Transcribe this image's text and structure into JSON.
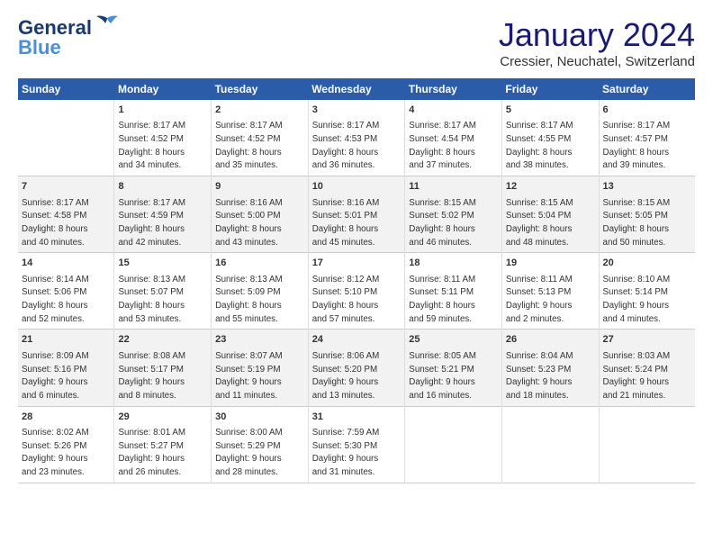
{
  "header": {
    "logo_general": "General",
    "logo_blue": "Blue",
    "main_title": "January 2024",
    "subtitle": "Cressier, Neuchatel, Switzerland"
  },
  "columns": [
    "Sunday",
    "Monday",
    "Tuesday",
    "Wednesday",
    "Thursday",
    "Friday",
    "Saturday"
  ],
  "weeks": [
    [
      {
        "num": "",
        "text": ""
      },
      {
        "num": "1",
        "text": "Sunrise: 8:17 AM\nSunset: 4:52 PM\nDaylight: 8 hours\nand 34 minutes."
      },
      {
        "num": "2",
        "text": "Sunrise: 8:17 AM\nSunset: 4:52 PM\nDaylight: 8 hours\nand 35 minutes."
      },
      {
        "num": "3",
        "text": "Sunrise: 8:17 AM\nSunset: 4:53 PM\nDaylight: 8 hours\nand 36 minutes."
      },
      {
        "num": "4",
        "text": "Sunrise: 8:17 AM\nSunset: 4:54 PM\nDaylight: 8 hours\nand 37 minutes."
      },
      {
        "num": "5",
        "text": "Sunrise: 8:17 AM\nSunset: 4:55 PM\nDaylight: 8 hours\nand 38 minutes."
      },
      {
        "num": "6",
        "text": "Sunrise: 8:17 AM\nSunset: 4:57 PM\nDaylight: 8 hours\nand 39 minutes."
      }
    ],
    [
      {
        "num": "7",
        "text": "Sunrise: 8:17 AM\nSunset: 4:58 PM\nDaylight: 8 hours\nand 40 minutes."
      },
      {
        "num": "8",
        "text": "Sunrise: 8:17 AM\nSunset: 4:59 PM\nDaylight: 8 hours\nand 42 minutes."
      },
      {
        "num": "9",
        "text": "Sunrise: 8:16 AM\nSunset: 5:00 PM\nDaylight: 8 hours\nand 43 minutes."
      },
      {
        "num": "10",
        "text": "Sunrise: 8:16 AM\nSunset: 5:01 PM\nDaylight: 8 hours\nand 45 minutes."
      },
      {
        "num": "11",
        "text": "Sunrise: 8:15 AM\nSunset: 5:02 PM\nDaylight: 8 hours\nand 46 minutes."
      },
      {
        "num": "12",
        "text": "Sunrise: 8:15 AM\nSunset: 5:04 PM\nDaylight: 8 hours\nand 48 minutes."
      },
      {
        "num": "13",
        "text": "Sunrise: 8:15 AM\nSunset: 5:05 PM\nDaylight: 8 hours\nand 50 minutes."
      }
    ],
    [
      {
        "num": "14",
        "text": "Sunrise: 8:14 AM\nSunset: 5:06 PM\nDaylight: 8 hours\nand 52 minutes."
      },
      {
        "num": "15",
        "text": "Sunrise: 8:13 AM\nSunset: 5:07 PM\nDaylight: 8 hours\nand 53 minutes."
      },
      {
        "num": "16",
        "text": "Sunrise: 8:13 AM\nSunset: 5:09 PM\nDaylight: 8 hours\nand 55 minutes."
      },
      {
        "num": "17",
        "text": "Sunrise: 8:12 AM\nSunset: 5:10 PM\nDaylight: 8 hours\nand 57 minutes."
      },
      {
        "num": "18",
        "text": "Sunrise: 8:11 AM\nSunset: 5:11 PM\nDaylight: 8 hours\nand 59 minutes."
      },
      {
        "num": "19",
        "text": "Sunrise: 8:11 AM\nSunset: 5:13 PM\nDaylight: 9 hours\nand 2 minutes."
      },
      {
        "num": "20",
        "text": "Sunrise: 8:10 AM\nSunset: 5:14 PM\nDaylight: 9 hours\nand 4 minutes."
      }
    ],
    [
      {
        "num": "21",
        "text": "Sunrise: 8:09 AM\nSunset: 5:16 PM\nDaylight: 9 hours\nand 6 minutes."
      },
      {
        "num": "22",
        "text": "Sunrise: 8:08 AM\nSunset: 5:17 PM\nDaylight: 9 hours\nand 8 minutes."
      },
      {
        "num": "23",
        "text": "Sunrise: 8:07 AM\nSunset: 5:19 PM\nDaylight: 9 hours\nand 11 minutes."
      },
      {
        "num": "24",
        "text": "Sunrise: 8:06 AM\nSunset: 5:20 PM\nDaylight: 9 hours\nand 13 minutes."
      },
      {
        "num": "25",
        "text": "Sunrise: 8:05 AM\nSunset: 5:21 PM\nDaylight: 9 hours\nand 16 minutes."
      },
      {
        "num": "26",
        "text": "Sunrise: 8:04 AM\nSunset: 5:23 PM\nDaylight: 9 hours\nand 18 minutes."
      },
      {
        "num": "27",
        "text": "Sunrise: 8:03 AM\nSunset: 5:24 PM\nDaylight: 9 hours\nand 21 minutes."
      }
    ],
    [
      {
        "num": "28",
        "text": "Sunrise: 8:02 AM\nSunset: 5:26 PM\nDaylight: 9 hours\nand 23 minutes."
      },
      {
        "num": "29",
        "text": "Sunrise: 8:01 AM\nSunset: 5:27 PM\nDaylight: 9 hours\nand 26 minutes."
      },
      {
        "num": "30",
        "text": "Sunrise: 8:00 AM\nSunset: 5:29 PM\nDaylight: 9 hours\nand 28 minutes."
      },
      {
        "num": "31",
        "text": "Sunrise: 7:59 AM\nSunset: 5:30 PM\nDaylight: 9 hours\nand 31 minutes."
      },
      {
        "num": "",
        "text": ""
      },
      {
        "num": "",
        "text": ""
      },
      {
        "num": "",
        "text": ""
      }
    ]
  ]
}
